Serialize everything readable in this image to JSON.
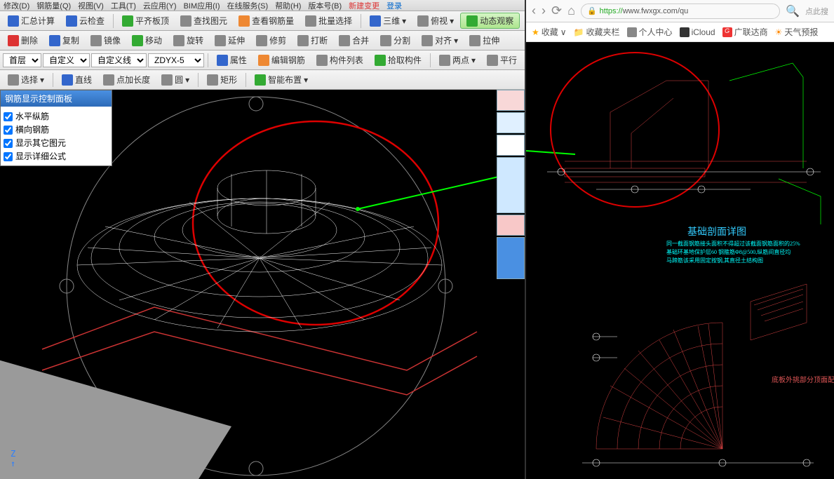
{
  "menubar": [
    "修改(D)",
    "钢筋量(Q)",
    "视图(V)",
    "工具(T)",
    "云应用(Y)",
    "BIM应用(I)",
    "在线服务(S)",
    "帮助(H)",
    "版本号(B)",
    "新建变更",
    "登录"
  ],
  "tb1": {
    "calc": "汇总计算",
    "cloud": "云检查",
    "flat": "平齐板顶",
    "find": "查找图元",
    "rebar": "查看钢筋量",
    "batch": "批量选择",
    "threed": "三维",
    "topview": "俯视",
    "dynview": "动态观察"
  },
  "tb2": {
    "del": "删除",
    "copy": "复制",
    "mirror": "镜像",
    "move": "移动",
    "rotate": "旋转",
    "extend": "延伸",
    "trim": "修剪",
    "break": "打断",
    "merge": "合并",
    "split": "分割",
    "align": "对齐",
    "stretch": "拉伸"
  },
  "tb3": {
    "floor": "首层",
    "custom": "自定义",
    "customline": "自定义线",
    "code": "ZDYX-5",
    "prop": "属性",
    "editrebar": "编辑钢筋",
    "complist": "构件列表",
    "pickcomp": "拾取构件",
    "twopoint": "两点",
    "parallel": "平行"
  },
  "tb4": {
    "select": "选择",
    "line": "直线",
    "addpoint": "点加长度",
    "circle": "圆",
    "rect": "矩形",
    "smartplace": "智能布置"
  },
  "panel": {
    "title": "钢筋显示控制面板",
    "item1": "水平纵筋",
    "item2": "横向钢筋",
    "item3": "显示其它图元",
    "item4": "显示详细公式"
  },
  "browser": {
    "url_domain": "www.fwxgx.com",
    "url_path": "/qu",
    "https": "https://",
    "search_hint": "点此搜"
  },
  "bookmarks": {
    "fav": "收藏",
    "favfolder": "收藏夹栏",
    "personal": "个人中心",
    "icloud": "iCloud",
    "glodon": "广联达商",
    "weather": "天气预报"
  },
  "cad_labels": {
    "title": "基础剖面详图",
    "subtitle": "底板外挑部分顶面配",
    "note1": "同一截面钢筋接头面积不得超过该截面钢筋面积的25%",
    "note2": "基础环基地保护层60   钢箍筋Φ8@500,纵筋间直径均",
    "note3": "马蹄筋该采用固定按钢,其直径土结构图"
  }
}
